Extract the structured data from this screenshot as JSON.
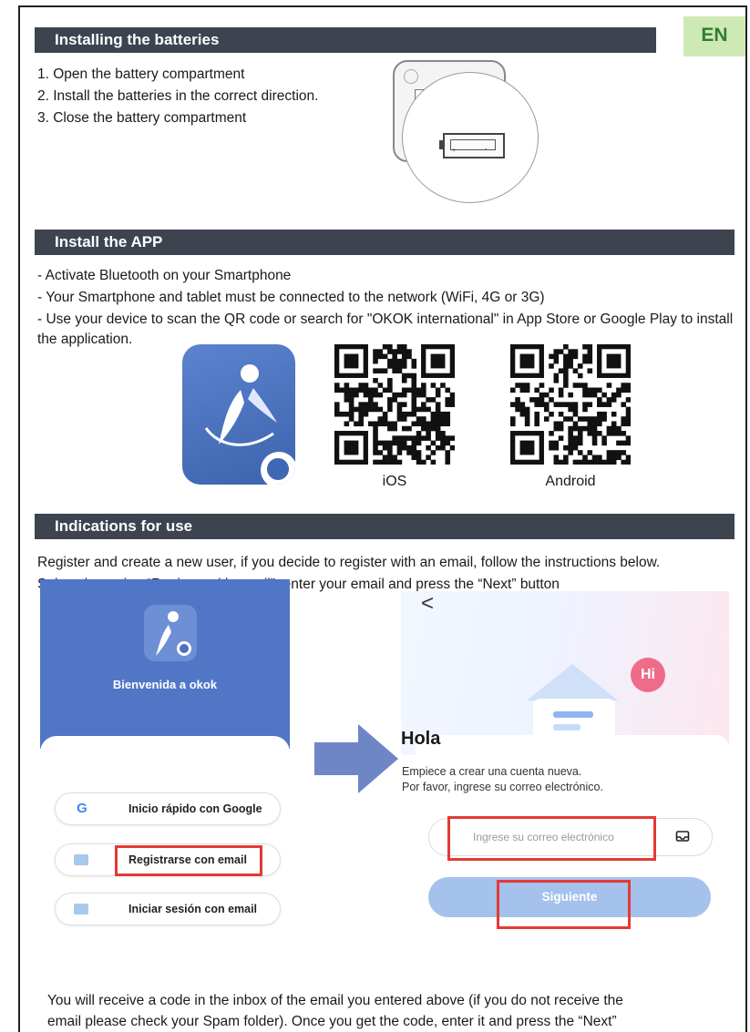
{
  "lang": "EN",
  "sections": {
    "batteries": "Installing the batteries",
    "app": "Install the APP",
    "indications": "Indications for use"
  },
  "battery_steps": [
    "1. Open the battery compartment",
    "2. Install the batteries in the correct direction.",
    "3. Close the battery compartment"
  ],
  "battery_marks": {
    "plus": "+",
    "minus": "-"
  },
  "app_lines": [
    "- Activate Bluetooth on your Smartphone",
    "- Your Smartphone and tablet must be connected to the network (WiFi, 4G or 3G)",
    "- Use your device to scan the QR code or search for \"OKOK international\" in App Store or Google Play to install the application."
  ],
  "qr": {
    "ios": "iOS",
    "android": "Android"
  },
  "indications_lines": [
    "Register and create a new user, if you decide to register with an email, follow the instructions below.",
    "Select the option “Register with email”, enter your email and press the “Next” button"
  ],
  "phone1": {
    "welcome": "Bienvenida a okok",
    "google_icon": "G",
    "options": [
      "Inicio rápido con Google",
      "Registrarse con email",
      "Iniciar sesión con email"
    ]
  },
  "phone2": {
    "back": "<",
    "hi": "Hi",
    "title": "Hola",
    "line1": "Empiece a crear una cuenta nueva.",
    "line2": "Por favor, ingrese su correo electrónico.",
    "email_placeholder": "Ingrese su correo electrónico",
    "next": "Siguiente"
  },
  "footer_lines": [
    "You will receive a code in the inbox of the email you entered above (if you do not receive the",
    "email please check your Spam folder). Once you get the code, enter it and press the “Next”"
  ],
  "colors": {
    "section_bar": "#3d4450",
    "badge_bg": "#cfe9b5",
    "badge_text": "#2e7d32",
    "highlight": "#e53935",
    "app_blue": "#5176c6"
  }
}
